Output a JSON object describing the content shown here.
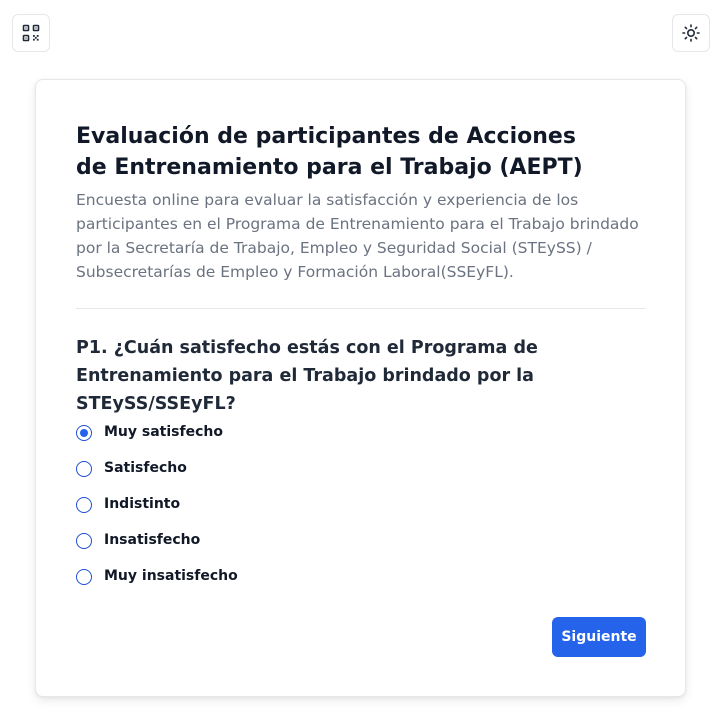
{
  "header": {
    "qr_icon": "qr-code-icon",
    "theme_icon": "sun-icon"
  },
  "survey": {
    "title": "Evaluación de participantes de Acciones de Entrenamiento para el Trabajo (AEPT)",
    "description": "Encuesta online para evaluar la satisfacción y experiencia de los participantes en el Programa de Entrenamiento para el Trabajo brindado por la Secretaría de Trabajo, Empleo y Seguridad Social (STEySS) / Subsecretarías de Empleo y Formación Laboral(SSEyFL).",
    "question": "P1. ¿Cuán satisfecho estás con el Programa de Entrenamiento para el Trabajo brindado por la STEySS/SSEyFL?",
    "options": [
      {
        "label": "Muy satisfecho",
        "selected": true
      },
      {
        "label": "Satisfecho",
        "selected": false
      },
      {
        "label": "Indistinto",
        "selected": false
      },
      {
        "label": "Insatisfecho",
        "selected": false
      },
      {
        "label": "Muy insatisfecho",
        "selected": false
      }
    ],
    "next_label": "Siguiente"
  },
  "colors": {
    "accent": "#2563eb",
    "title": "#111827",
    "description": "#6b7280",
    "border": "#e5e7eb"
  }
}
